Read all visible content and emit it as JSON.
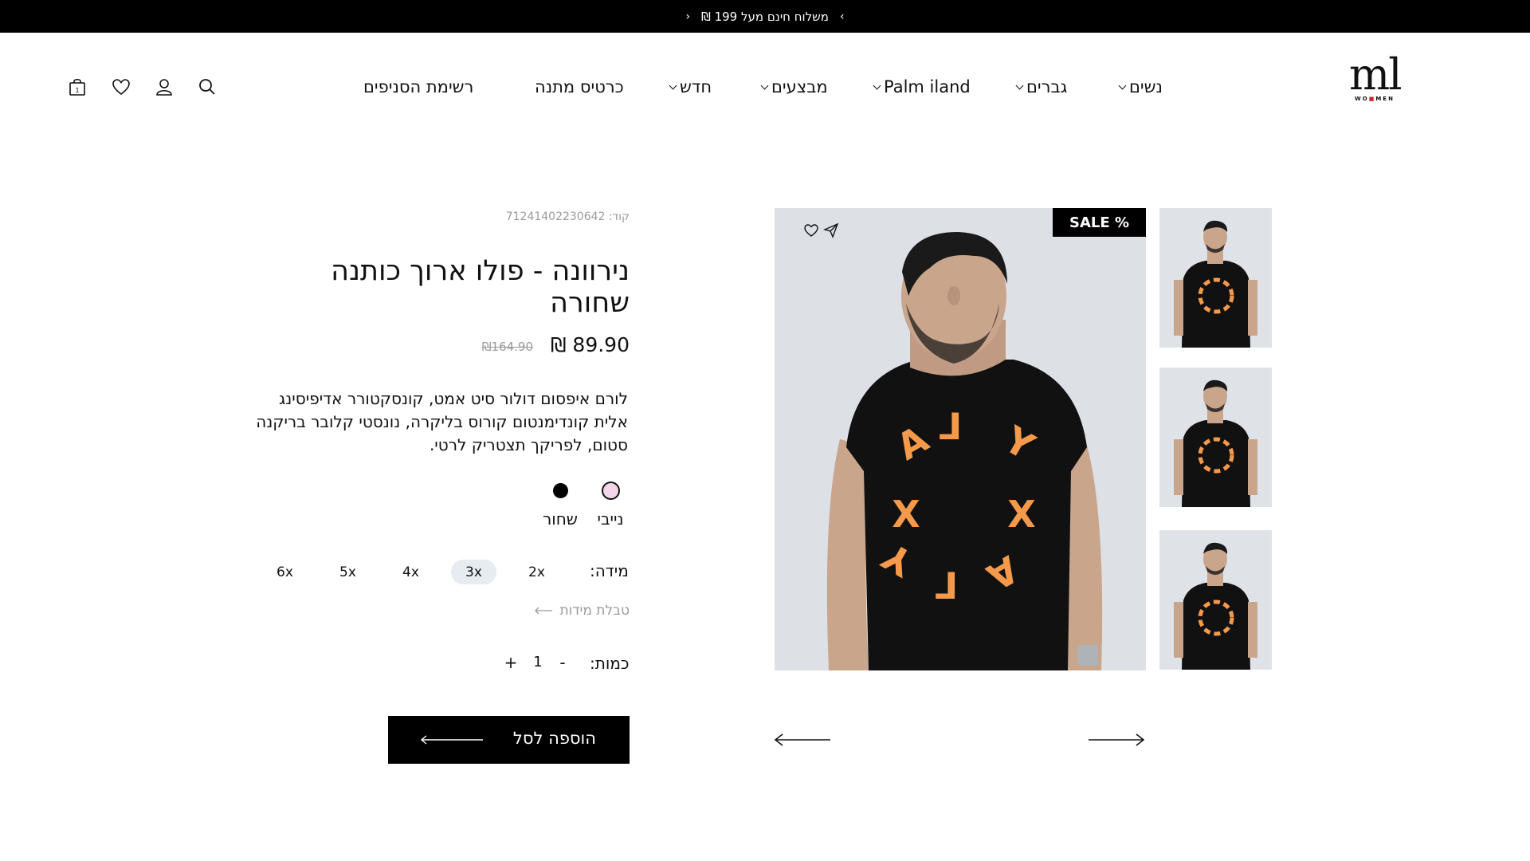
{
  "announcement": {
    "text": "משלוח חינם מעל 199 ₪"
  },
  "logo": {
    "mark": "ml",
    "sub": "WOMEN"
  },
  "nav": {
    "women": "נשים",
    "men": "גברים",
    "palm": "Palm iland",
    "sales": "מבצעים",
    "new": "חדש",
    "gift_cards": "כרטיס מתנה",
    "branches": "רשימת הסניפים"
  },
  "gallery": {
    "sale_badge": "SALE %",
    "thumbnail_count": 3
  },
  "product": {
    "sku": "קוד: 71241402230642",
    "title": "נירוונה - פולו ארוך כותנה שחורה",
    "price": "89.90 ₪",
    "old_price": "₪164.90",
    "description": "לורם איפסום דולור סיט אמט, קונסקטורר אדיפיסינג אלית קונדימנטום קורוס בליקרה, נונסטי קלובר בריקנה סטום, לפריקך תצטריק לרטי.",
    "colors": [
      {
        "name": "נייבי",
        "swatch": "#f3d6ea",
        "ring": "#111111",
        "selected": true
      },
      {
        "name": "שחור",
        "swatch": "#000000",
        "ring": "#000000",
        "selected": false
      }
    ],
    "size_label": "מידה:",
    "sizes": [
      "2x",
      "3x",
      "4x",
      "5x",
      "6x"
    ],
    "selected_size": "3x",
    "size_chart": "טבלת מידות",
    "qty_label": "כמות:",
    "qty": "1",
    "qty_minus": "-",
    "qty_plus": "+",
    "add_to_cart": "הוספה לסל"
  },
  "colors": {
    "black": "#000000",
    "print": "#f59a4b",
    "muted": "#9a9a9a",
    "selected_size_bg": "#e7ecf1"
  }
}
